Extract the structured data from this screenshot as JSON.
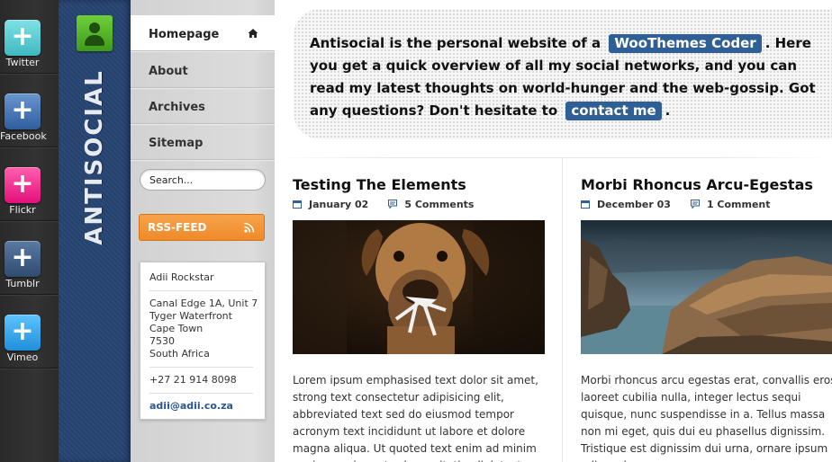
{
  "social": [
    {
      "label": "Twitter",
      "color": "#56c9cf"
    },
    {
      "label": "Facebook",
      "color": "#3d6fb0"
    },
    {
      "label": "Flickr",
      "color": "#f21e86"
    },
    {
      "label": "Tumblr",
      "color": "#3a5a80"
    },
    {
      "label": "Vimeo",
      "color": "#2e9fe6"
    }
  ],
  "brand": {
    "name": "ANTISOCIAL",
    "avatar_icon": "user-icon"
  },
  "nav": {
    "items": [
      {
        "label": "Homepage",
        "active": true
      },
      {
        "label": "About"
      },
      {
        "label": "Archives"
      },
      {
        "label": "Sitemap"
      }
    ],
    "home_icon": "home-icon"
  },
  "search": {
    "value": "Search..."
  },
  "rss": {
    "label": "RSS-FEED",
    "icon": "rss-icon"
  },
  "vcard": {
    "name": "Adii Rockstar",
    "address": [
      "Canal Edge 1A, Unit 7",
      "Tyger Waterfront",
      "Cape Town",
      "7530",
      "South Africa"
    ],
    "phone": "+27 21 914 8098",
    "email": "adii@adii.co.za"
  },
  "intro": {
    "part1": "Antisocial is the personal website of a",
    "link1": "WooThemes Coder",
    "part2": ". Here you get a quick overview of all my social networks, and you can read my latest thoughts on world-hunger and the web-gossip. Got any questions? Don't hesitate to",
    "link2": "contact me",
    "part3": "."
  },
  "posts": [
    {
      "title": "Testing The Elements",
      "date": "January 02",
      "comments": "5 Comments",
      "excerpt": "Lorem ipsum emphasised text dolor sit amet, strong text consectetur adipisicing elit, abbreviated text sed do eiusmod tempor acronym text incididunt ut labore et dolore magna aliqua. Ut quoted text enim ad minim veniam, quis nostrud exercitation link text"
    },
    {
      "title": "Morbi Rhoncus Arcu-Egestas",
      "date": "December 03",
      "comments": "1 Comment",
      "excerpt": "Morbi rhoncus arcu egestas erat, convallis eros laoreet cubilia nulla, integer lectus sequi quisque, nunc suspendisse in a. Tellus massa non mi eget, quis dui eu phasellus dignissim. Tristique est dignissim dui urna, ornare ipsum odio sed"
    }
  ]
}
